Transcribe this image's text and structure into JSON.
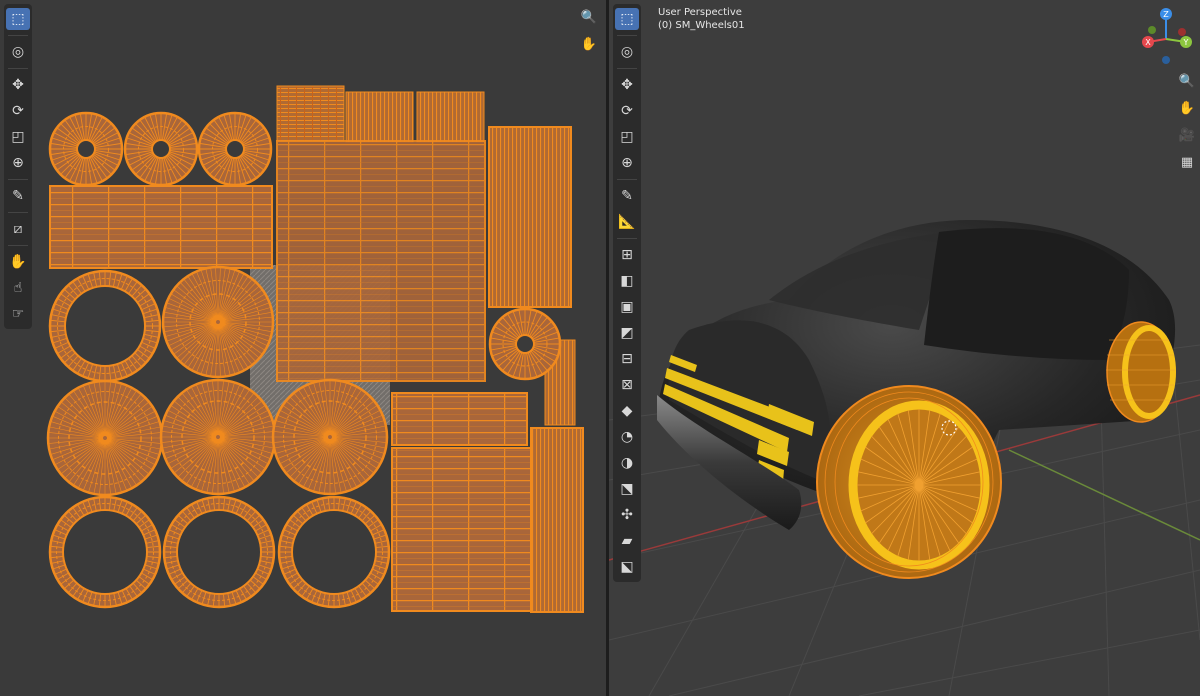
{
  "uv_editor": {
    "toolbar": [
      {
        "name": "select-box-icon",
        "glyph": "⬚"
      },
      {
        "name": "cursor-icon",
        "glyph": "◎"
      },
      {
        "name": "move-icon",
        "glyph": "✥"
      },
      {
        "name": "rotate-icon",
        "glyph": "⟳"
      },
      {
        "name": "scale-icon",
        "glyph": "◰"
      },
      {
        "name": "transform-icon",
        "glyph": "⊕"
      },
      {
        "name": "annotate-icon",
        "glyph": "✎"
      },
      {
        "name": "rip-region-icon",
        "glyph": "⧄"
      },
      {
        "name": "grab-icon",
        "glyph": "✋"
      },
      {
        "name": "relax-icon",
        "glyph": "☝"
      },
      {
        "name": "pinch-icon",
        "glyph": "☞"
      }
    ],
    "nav": [
      {
        "name": "zoom-icon",
        "glyph": "🔍"
      },
      {
        "name": "hand-pan-icon",
        "glyph": "✋"
      }
    ]
  },
  "viewport": {
    "perspective": "User Perspective",
    "object": "(0) SM_Wheels01",
    "gizmo": {
      "z": "Z",
      "y": "Y",
      "x": "X"
    },
    "colors": {
      "x": "#e5484d",
      "y": "#8cc63f",
      "z": "#3b8ee8",
      "selection": "#f08a1e",
      "body": "#262626",
      "stripe": "#e8c21a"
    },
    "toolbar": [
      {
        "name": "select-box-icon",
        "glyph": "⬚"
      },
      {
        "name": "cursor-icon",
        "glyph": "◎"
      },
      {
        "name": "move-icon",
        "glyph": "✥"
      },
      {
        "name": "rotate-icon",
        "glyph": "⟳"
      },
      {
        "name": "scale-icon",
        "glyph": "◰"
      },
      {
        "name": "transform-icon",
        "glyph": "⊕"
      },
      {
        "name": "annotate-icon",
        "glyph": "✎"
      },
      {
        "name": "measure-icon",
        "glyph": "📐"
      },
      {
        "name": "add-cube-icon",
        "glyph": "⊞"
      },
      {
        "name": "extrude-icon",
        "glyph": "◧"
      },
      {
        "name": "inset-icon",
        "glyph": "▣"
      },
      {
        "name": "bevel-icon",
        "glyph": "◩"
      },
      {
        "name": "loop-cut-icon",
        "glyph": "⊟"
      },
      {
        "name": "knife-icon",
        "glyph": "⊠"
      },
      {
        "name": "poly-build-icon",
        "glyph": "◆"
      },
      {
        "name": "spin-icon",
        "glyph": "◔"
      },
      {
        "name": "smooth-icon",
        "glyph": "◑"
      },
      {
        "name": "edge-slide-icon",
        "glyph": "⬔"
      },
      {
        "name": "shrink-fatten-icon",
        "glyph": "✣"
      },
      {
        "name": "shear-icon",
        "glyph": "▰"
      },
      {
        "name": "rip-icon",
        "glyph": "⬕"
      }
    ],
    "nav": [
      {
        "name": "zoom-icon",
        "glyph": "🔍"
      },
      {
        "name": "hand-pan-icon",
        "glyph": "✋"
      },
      {
        "name": "camera-icon",
        "glyph": "🎥"
      },
      {
        "name": "grid-view-icon",
        "glyph": "▦"
      }
    ]
  }
}
